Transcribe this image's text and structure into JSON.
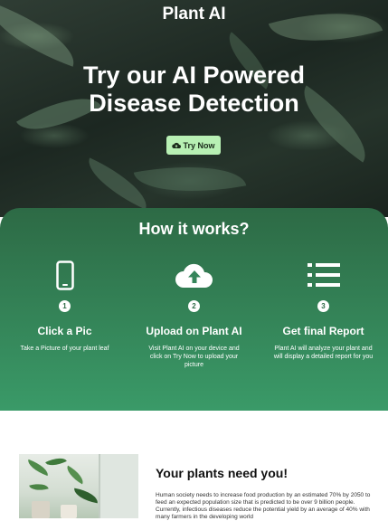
{
  "hero": {
    "brand": "Plant AI",
    "headline_line1": "Try our AI Powered",
    "headline_line2": "Disease Detection",
    "cta_label": "Try Now"
  },
  "how_it_works": {
    "title": "How it works?",
    "steps": [
      {
        "number": "1",
        "icon": "phone-icon",
        "title": "Click a Pic",
        "description": "Take a Picture of your plant leaf"
      },
      {
        "number": "2",
        "icon": "cloud-upload-icon",
        "title": "Upload on Plant AI",
        "description": "Visit Plant AI on your device and click on Try Now to upload your picture"
      },
      {
        "number": "3",
        "icon": "list-icon",
        "title": "Get final Report",
        "description": "Plant AI will analyze your plant and will display a detailed report for you"
      }
    ]
  },
  "plants_section": {
    "title": "Your plants need you!",
    "body": "Human society needs to increase food production by an estimated 70% by 2050 to feed an expected population size that is predicted to be over 9 billion people. Currently, infectious diseases reduce the potential yield by an average of 40% with many farmers in the developing world"
  },
  "colors": {
    "accent": "#3a9a68",
    "cta": "#b8f0b4",
    "dark_green": "#2d6a45"
  }
}
